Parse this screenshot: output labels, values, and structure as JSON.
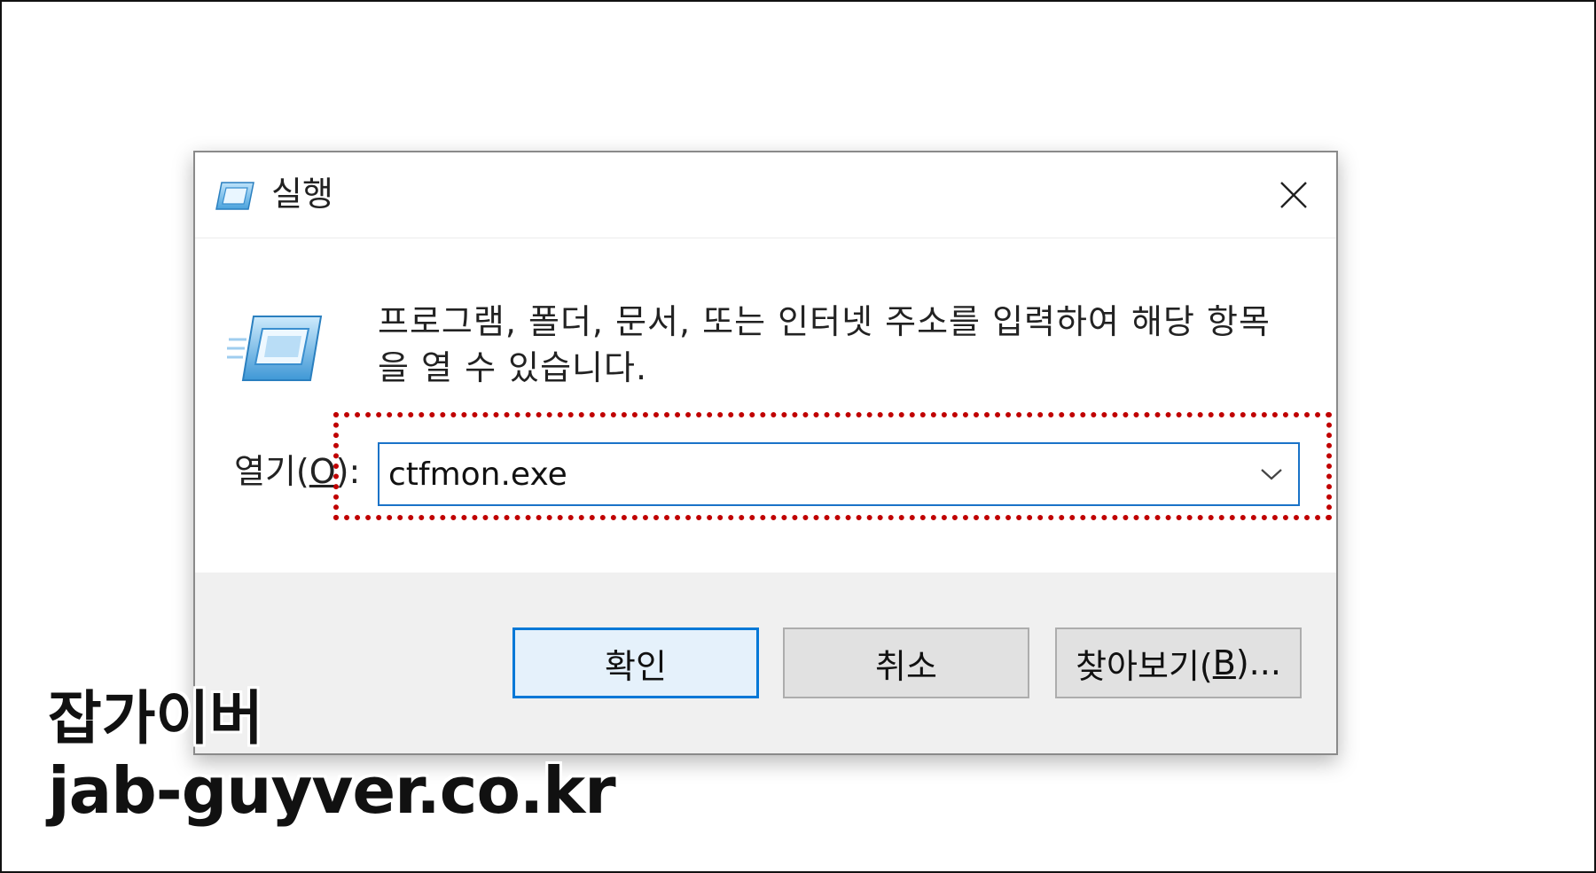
{
  "dialog": {
    "title": "실행",
    "description": "프로그램, 폴더, 문서, 또는 인터넷 주소를 입력하여 해당 항목을 열 수 있습니다.",
    "open_label_prefix": "열기(",
    "open_label_access": "O",
    "open_label_suffix": "):",
    "open_value": "ctfmon.exe",
    "buttons": {
      "ok": "확인",
      "cancel": "취소",
      "browse_prefix": "찾아보기(",
      "browse_access": "B",
      "browse_suffix": ")..."
    }
  },
  "watermark": {
    "line1": "잡가이버",
    "line2": "jab-guyver.co.kr"
  },
  "icons": {
    "title": "run-icon",
    "large": "run-icon",
    "close": "close-icon",
    "dropdown": "chevron-down-icon"
  },
  "colors": {
    "highlight": "#c00000",
    "focus_border": "#0078d7",
    "footer_bg": "#f0f0f0"
  }
}
